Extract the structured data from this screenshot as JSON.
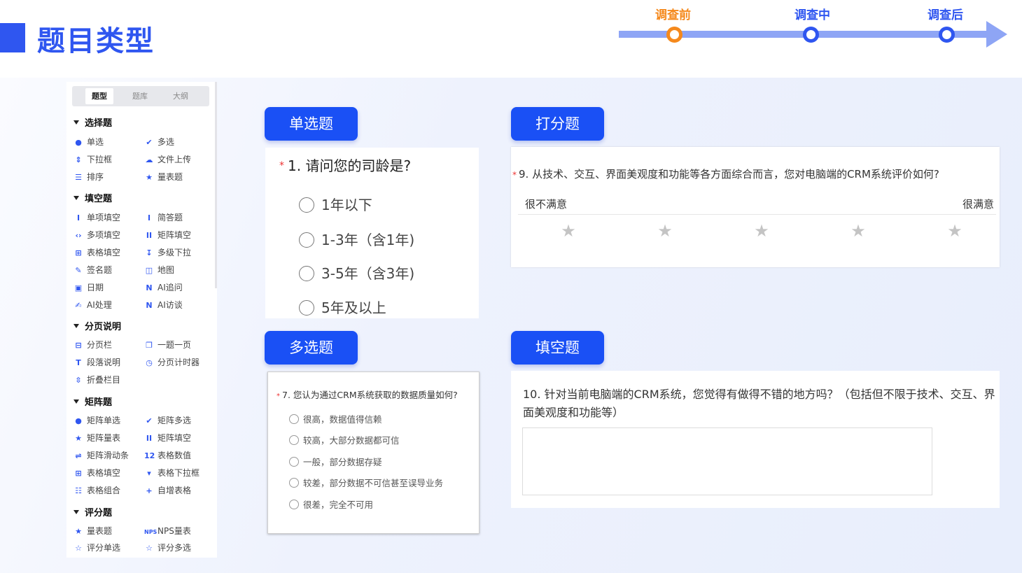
{
  "header": {
    "title": "题目类型",
    "timeline": [
      "调查前",
      "调查中",
      "调查后"
    ]
  },
  "sidebar": {
    "tabs": [
      "题型",
      "题库",
      "大纲"
    ],
    "groups": {
      "choice": {
        "title": "选择题",
        "items": [
          "单选",
          "多选",
          "下拉框",
          "文件上传",
          "排序",
          "量表题"
        ]
      },
      "fill": {
        "title": "填空题",
        "items": [
          "单项填空",
          "简答题",
          "多项填空",
          "矩阵填空",
          "表格填空",
          "多级下拉",
          "签名题",
          "地图",
          "日期",
          "AI追问",
          "AI处理",
          "AI访谈"
        ]
      },
      "paging": {
        "title": "分页说明",
        "items": [
          "分页栏",
          "一题一页",
          "段落说明",
          "分页计时器",
          "折叠栏目"
        ]
      },
      "matrix": {
        "title": "矩阵题",
        "items": [
          "矩阵单选",
          "矩阵多选",
          "矩阵量表",
          "矩阵填空",
          "矩阵滑动条",
          "表格数值",
          "表格填空",
          "表格下拉框",
          "表格组合",
          "自增表格"
        ]
      },
      "rating": {
        "title": "评分题",
        "items": [
          "量表题",
          "NPS量表",
          "评分单选",
          "评分多选"
        ]
      }
    }
  },
  "sections": {
    "single": {
      "tag": "单选题",
      "required_mark": "*",
      "question": "1. 请问您的司龄是?",
      "options": [
        "1年以下",
        "1-3年（含1年)",
        "3-5年（含3年)",
        "5年及以上"
      ]
    },
    "score": {
      "tag": "打分题",
      "required_mark": "*",
      "question": "9. 从技术、交互、界面美观度和功能等各方面综合而言，您对电脑端的CRM系统评价如何?",
      "low_label": "很不满意",
      "high_label": "很满意",
      "stars": 5
    },
    "multi": {
      "tag": "多选题",
      "required_mark": "*",
      "question": "7. 您认为通过CRM系统获取的数据质量如何?",
      "options": [
        "很高，数据值得信赖",
        "较高，大部分数据都可信",
        "一般，部分数据存疑",
        "较差，部分数据不可信甚至误导业务",
        "很差，完全不可用"
      ]
    },
    "fill": {
      "tag": "填空题",
      "question": "10. 针对当前电脑端的CRM系统，您觉得有做得不错的地方吗？（包括但不限于技术、交互、界面美观度和功能等）"
    }
  },
  "colors": {
    "brand": "#2f56f0",
    "tag_bg": "#1a50f5",
    "timeline_line": "#8ea5f5",
    "pre": "#f5891c",
    "required": "#e33333"
  }
}
